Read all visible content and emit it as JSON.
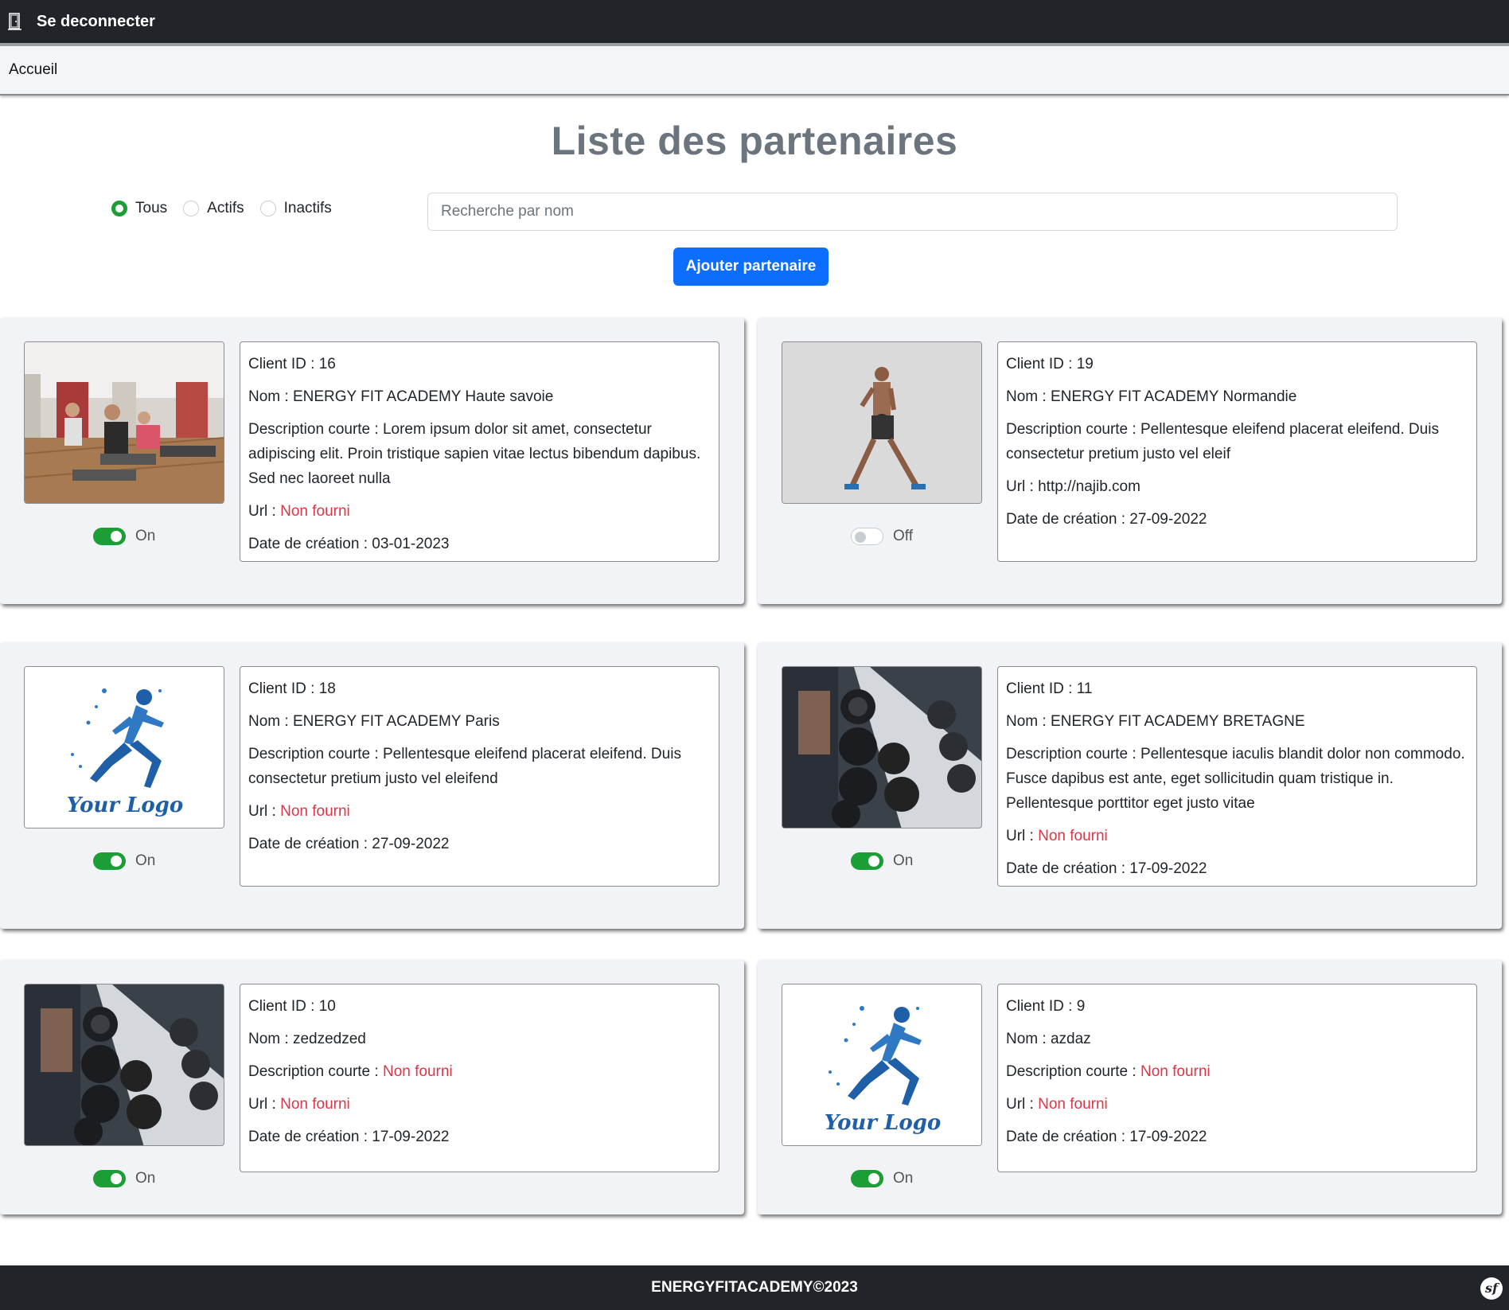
{
  "topbar": {
    "logout_label": "Se deconnecter",
    "icon": "door-icon"
  },
  "navbar": {
    "home_label": "Accueil"
  },
  "page_title": "Liste des partenaires",
  "filters": {
    "options": [
      "Tous",
      "Actifs",
      "Inactifs"
    ],
    "selected": "Tous"
  },
  "search": {
    "placeholder": "Recherche par nom",
    "value": ""
  },
  "add_button_label": "Ajouter partenaire",
  "labels": {
    "client_id": "Client ID : ",
    "nom": "Nom : ",
    "description": "Description courte : ",
    "url": "Url : ",
    "date": "Date de création : "
  },
  "partners": [
    {
      "client_id": "16",
      "nom": "ENERGY FIT ACADEMY Haute savoie",
      "description": "Lorem ipsum dolor sit amet, consectetur adipiscing elit. Proin tristique sapien vitae lectus bibendum dapibus. Sed nec laoreet nulla",
      "url": "Non fourni",
      "date": "03-01-2023",
      "status": "On",
      "image": "fitness-class-photo"
    },
    {
      "client_id": "19",
      "nom": "ENERGY FIT ACADEMY Normandie",
      "description": "Pellentesque eleifend placerat eleifend. Duis consectetur pretium justo vel eleif",
      "url": "http://najib.com",
      "date": "27-09-2022",
      "status": "Off",
      "image": "athlete-kettlebell-photo"
    },
    {
      "client_id": "18",
      "nom": "ENERGY FIT ACADEMY Paris",
      "description": "Pellentesque eleifend placerat eleifend. Duis consectetur pretium justo vel eleifend",
      "url": "Non fourni",
      "date": "27-09-2022",
      "status": "On",
      "image": "your-logo-runner"
    },
    {
      "client_id": "11",
      "nom": "ENERGY FIT ACADEMY BRETAGNE",
      "description": "Pellentesque iaculis blandit dolor non commodo. Fusce dapibus est ante, eget sollicitudin quam tristique in. Pellentesque porttitor eget justo vitae",
      "url": "Non fourni",
      "date": "17-09-2022",
      "status": "On",
      "image": "dumbbell-rack-photo"
    },
    {
      "client_id": "10",
      "nom": "zedzedzed",
      "description": "Non fourni",
      "url": "Non fourni",
      "date": "17-09-2022",
      "status": "On",
      "image": "dumbbell-rack-photo"
    },
    {
      "client_id": "9",
      "nom": "azdaz",
      "description": "Non fourni",
      "url": "Non fourni",
      "date": "17-09-2022",
      "status": "On",
      "image": "your-logo-runner"
    }
  ],
  "logo_text": "Your Logo",
  "footer": {
    "copyright": "ENERGYFITACADEMY©2023",
    "badge": "sf"
  },
  "colors": {
    "topbar": "#212529",
    "primary": "#0d6efd",
    "success": "#1a9e35",
    "missing": "#dc3545",
    "title": "#6c757d"
  }
}
